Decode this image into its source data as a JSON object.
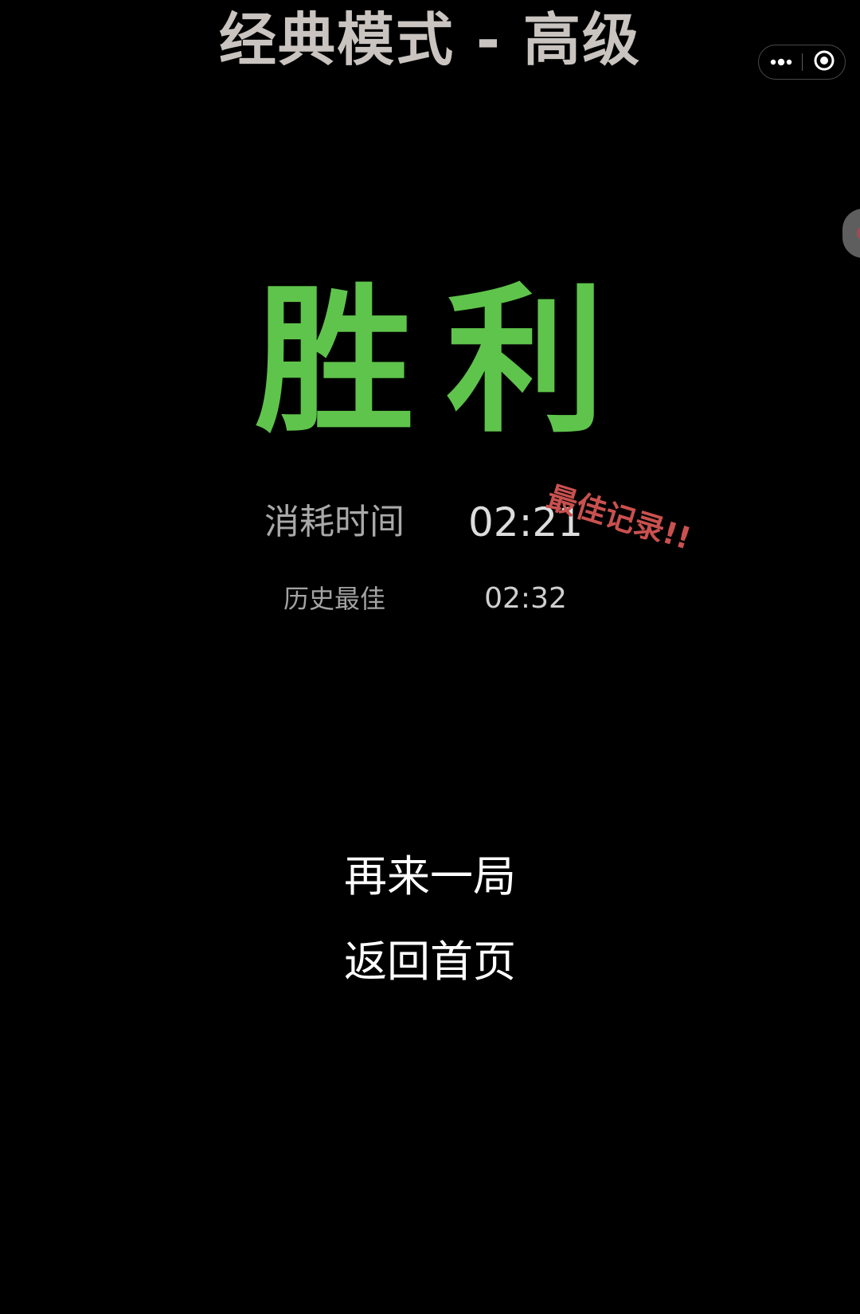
{
  "header": {
    "title": "经典模式 - 高级"
  },
  "capsule": {
    "more_icon": "more-dots-icon",
    "close_icon": "target-circle-icon"
  },
  "result": {
    "headline": "胜利",
    "record_badge": "最佳记录!!",
    "time_label": "消耗时间",
    "time_value": "02:21",
    "best_label": "历史最佳",
    "best_value": "02:32"
  },
  "actions": {
    "play_again": "再来一局",
    "go_home": "返回首页"
  },
  "colors": {
    "background": "#000000",
    "headline": "#5fc44b",
    "badge": "#c9514f",
    "title": "#c9c4c0"
  }
}
